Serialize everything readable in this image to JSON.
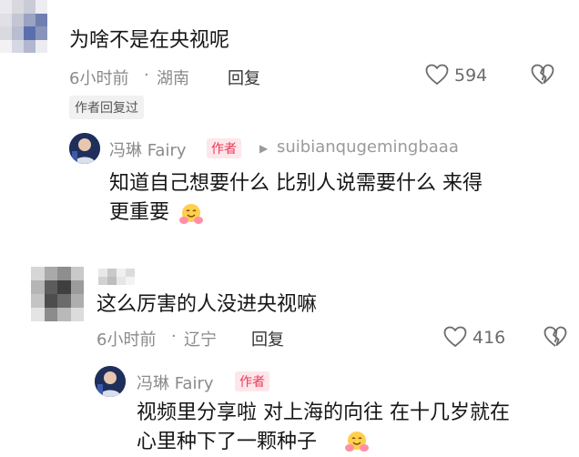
{
  "comment1": {
    "text": "为啥不是在央视呢",
    "time": "6小时前",
    "separator": "·",
    "location": "湖南",
    "reply_label": "回复",
    "likes": "594",
    "author_replied_tag": "作者回复过"
  },
  "reply1": {
    "author_name": "冯琳 Fairy",
    "author_badge": "作者",
    "reply_to_arrow": "▶",
    "reply_to_user": "suibianqugemingbaaa",
    "text_line1": "知道自己想要什么 比别人说需要什么 来得",
    "text_line2": "更重要",
    "emoji_name": "hugging-face-icon"
  },
  "comment2": {
    "text": "这么厉害的人没进央视嘛",
    "time": "6小时前",
    "separator": "·",
    "location": "辽宁",
    "reply_label": "回复",
    "likes": "416"
  },
  "reply2": {
    "author_name": "冯琳 Fairy",
    "author_badge": "作者",
    "text_line1": "视频里分享啦 对上海的向往 在十几岁就在",
    "text_line2": "心里种下了一颗种子",
    "emoji_name": "hugging-face-icon"
  },
  "colors": {
    "author_badge_bg": "#fde7ea",
    "author_badge_text": "#e8395a",
    "meta_gray": "#8a8a8a",
    "text": "#161616"
  }
}
